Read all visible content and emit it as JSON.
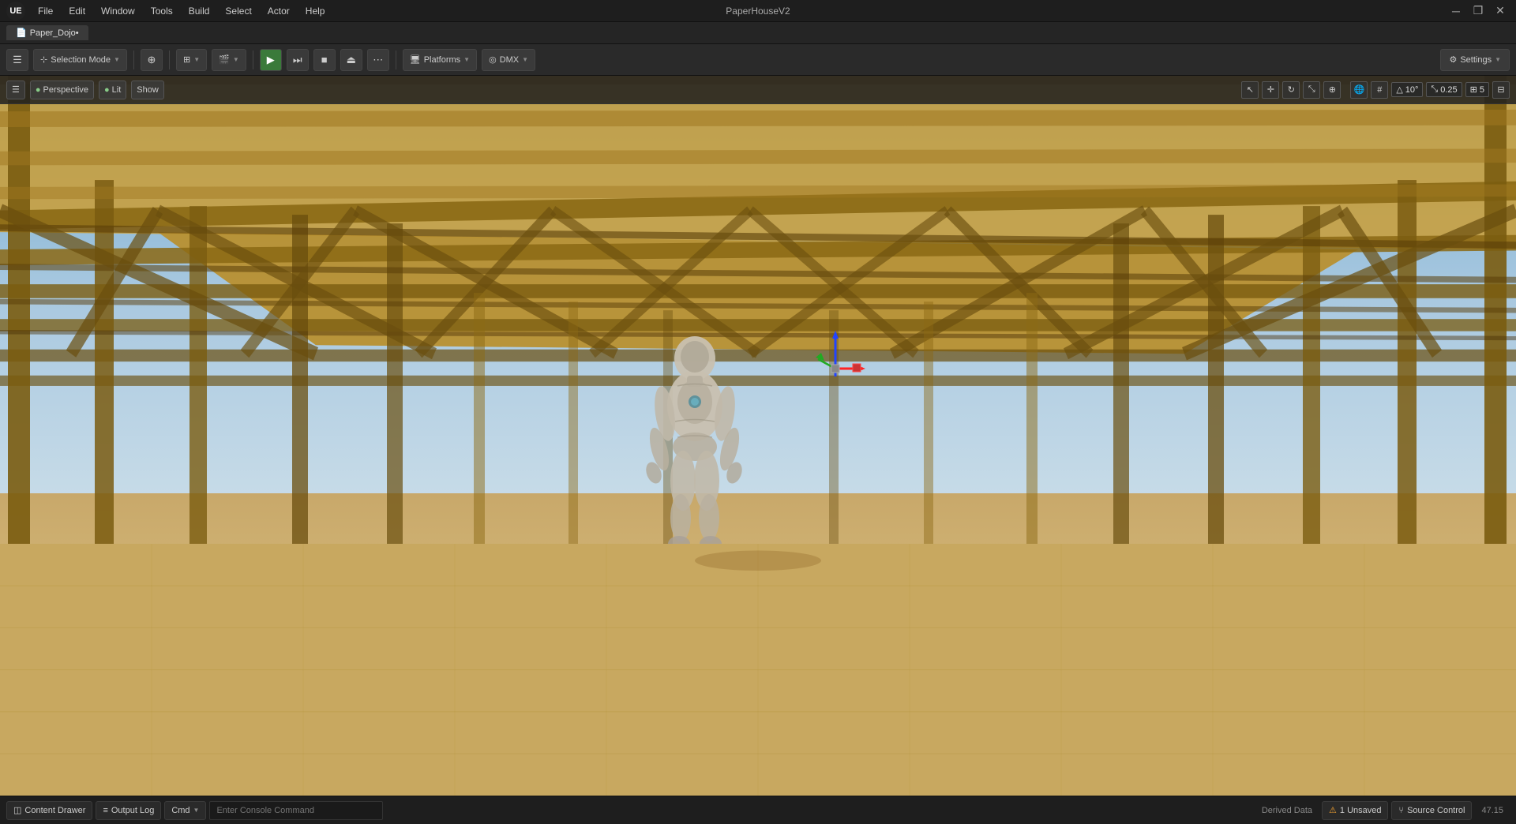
{
  "titleBar": {
    "title": "PaperHouseV2",
    "windowControls": {
      "minimize": "─",
      "restore": "❐",
      "close": "✕"
    },
    "menuItems": [
      "File",
      "Edit",
      "Window",
      "Tools",
      "Build",
      "Select",
      "Actor",
      "Help"
    ]
  },
  "projectBar": {
    "tabName": "Paper_Dojo•"
  },
  "mainToolbar": {
    "selectionMode": "Selection Mode",
    "platforms": "Platforms",
    "dmx": "DMX",
    "settings": "Settings"
  },
  "viewportToolbar": {
    "hamburger": "☰",
    "perspective": "Perspective",
    "lit": "Lit",
    "show": "Show",
    "rotationDeg": "10°",
    "scaleValue": "0.25",
    "gridValue": "5"
  },
  "statusBar": {
    "contentDrawer": "Content Drawer",
    "outputLog": "Output Log",
    "cmd": "Cmd",
    "cmdPlaceholder": "Enter Console Command",
    "derivedData": "Derived Data",
    "unsaved": "1 Unsaved",
    "sourceControl": "Source Control",
    "fps": "47.15"
  }
}
